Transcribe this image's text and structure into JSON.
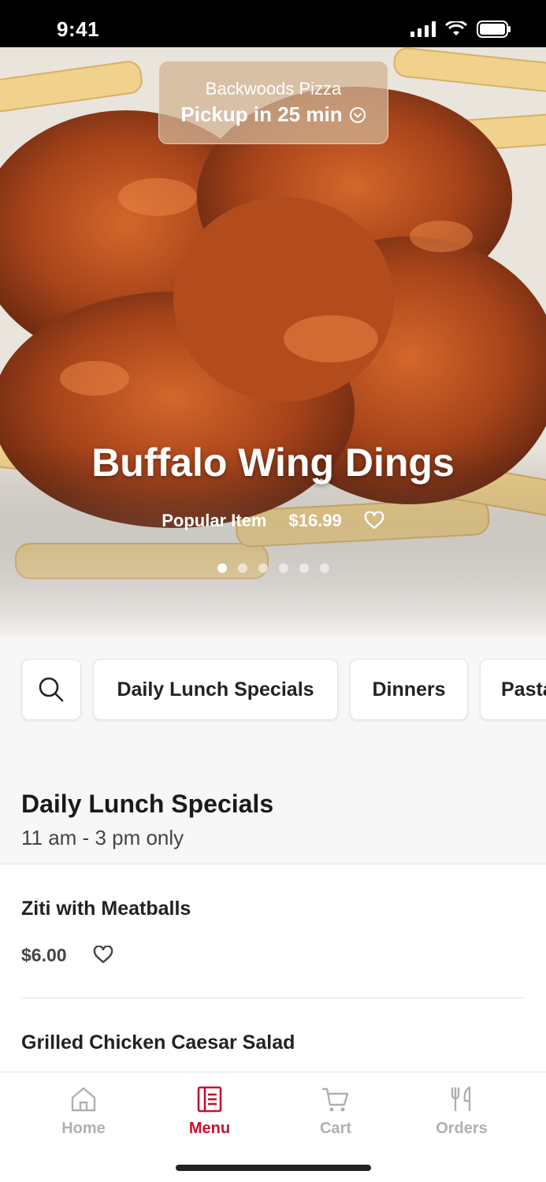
{
  "status_bar": {
    "time": "9:41"
  },
  "pickup_banner": {
    "restaurant": "Backwoods Pizza",
    "eta": "Pickup in 25 min"
  },
  "hero": {
    "title": "Buffalo Wing Dings",
    "tag": "Popular Item",
    "price": "$16.99",
    "slide_count": 6,
    "active_slide": 1
  },
  "categories": [
    "Daily Lunch Specials",
    "Dinners",
    "Pasta"
  ],
  "section": {
    "title": "Daily Lunch Specials",
    "subtitle": "11 am - 3 pm only"
  },
  "menu_items": [
    {
      "name": "Ziti with Meatballs",
      "price": "$6.00"
    },
    {
      "name": "Grilled Chicken Caesar Salad",
      "price": ""
    }
  ],
  "tab_bar": {
    "tabs": [
      {
        "label": "Home",
        "icon": "home-icon"
      },
      {
        "label": "Menu",
        "icon": "menu-book-icon"
      },
      {
        "label": "Cart",
        "icon": "cart-icon"
      },
      {
        "label": "Orders",
        "icon": "fork-knife-icon"
      }
    ],
    "active": "Menu"
  },
  "colors": {
    "accent": "#c8102e",
    "inactive_tab": "#b0b0b0"
  }
}
